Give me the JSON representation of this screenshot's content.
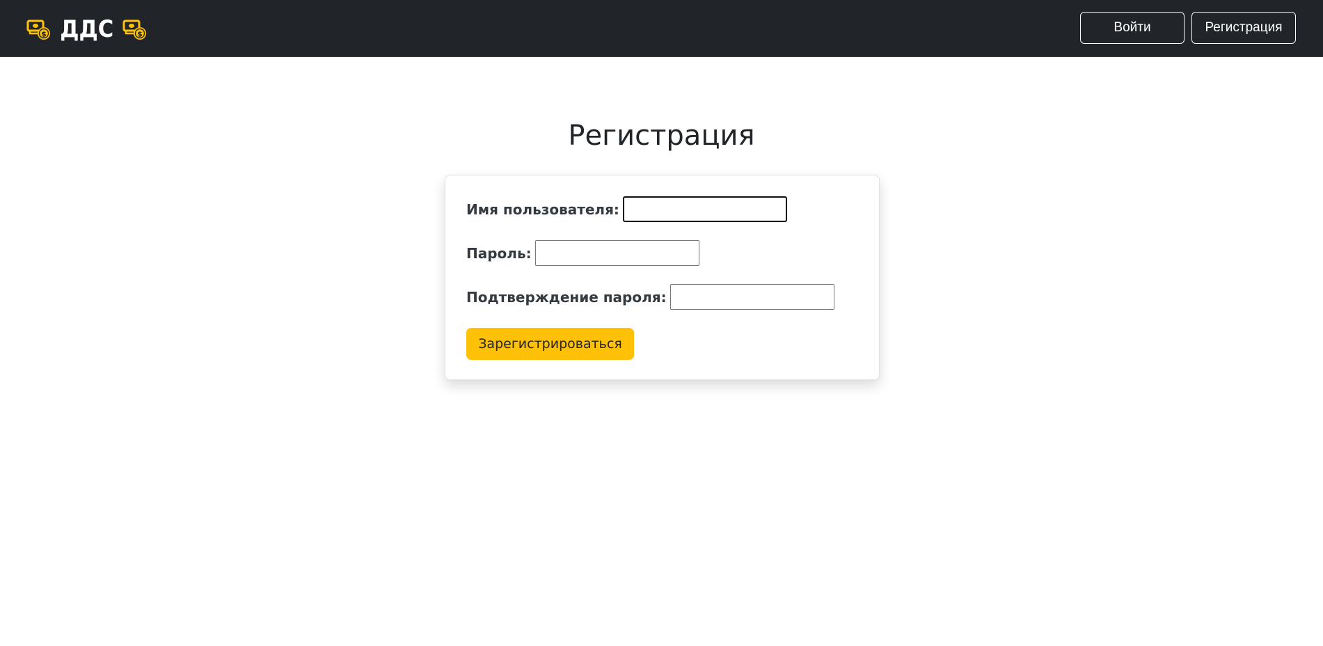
{
  "brand": {
    "name": "ДДС",
    "icon": "money-icon",
    "accent_color": "#ffc107"
  },
  "nav": {
    "login_label": "Войти",
    "register_label": "Регистрация"
  },
  "page": {
    "title": "Регистрация"
  },
  "form": {
    "username_label": "Имя пользователя:",
    "username_value": "",
    "password_label": "Пароль:",
    "password_value": "",
    "confirm_label": "Подтверждение пароля:",
    "confirm_value": "",
    "submit_label": "Зарегистрироваться"
  },
  "colors": {
    "navbar_bg": "#212529",
    "submit_bg": "#ffc107"
  }
}
